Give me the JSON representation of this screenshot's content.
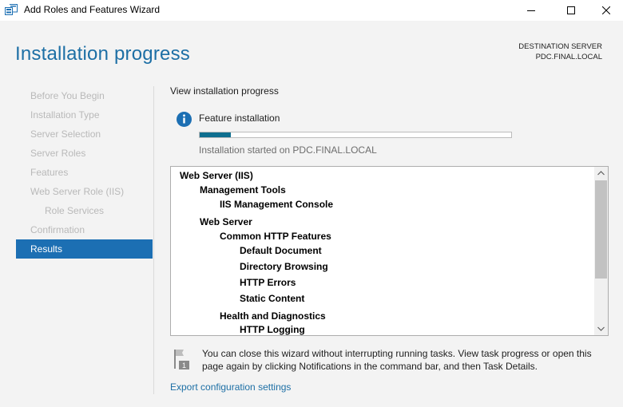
{
  "window": {
    "title": "Add Roles and Features Wizard",
    "icon": "server-manager-icon",
    "controls": [
      "minimize-icon",
      "maximize-icon",
      "close-icon"
    ]
  },
  "header": {
    "page_title": "Installation progress",
    "destination_label": "DESTINATION SERVER",
    "destination_value": "PDC.FINAL.LOCAL"
  },
  "nav": {
    "items": [
      {
        "label": "Before You Begin",
        "state": "disabled"
      },
      {
        "label": "Installation Type",
        "state": "disabled"
      },
      {
        "label": "Server Selection",
        "state": "disabled"
      },
      {
        "label": "Server Roles",
        "state": "disabled"
      },
      {
        "label": "Features",
        "state": "disabled"
      },
      {
        "label": "Web Server Role (IIS)",
        "state": "disabled"
      },
      {
        "label": "Role Services",
        "state": "disabled"
      },
      {
        "label": "Confirmation",
        "state": "disabled"
      },
      {
        "label": "Results",
        "state": "active"
      }
    ]
  },
  "content": {
    "section_label": "View installation progress",
    "feature_label": "Feature installation",
    "progress_fraction": 0.1,
    "status_text": "Installation started on PDC.FINAL.LOCAL",
    "results": [
      {
        "text": "Web Server (IIS)",
        "level": 0
      },
      {
        "text": "Management Tools",
        "level": 1
      },
      {
        "text": "IIS Management Console",
        "level": 2
      },
      {
        "text": "Web Server",
        "level": 1
      },
      {
        "text": "Common HTTP Features",
        "level": 2
      },
      {
        "text": "Default Document",
        "level": 3
      },
      {
        "text": "Directory Browsing",
        "level": 3
      },
      {
        "text": "HTTP Errors",
        "level": 3
      },
      {
        "text": "Static Content",
        "level": 3
      },
      {
        "text": "Health and Diagnostics",
        "level": 2
      },
      {
        "text": "HTTP Logging",
        "level": 3
      }
    ],
    "note": "You can close this wizard without interrupting running tasks. View task progress or open this page again by clicking Notifications in the command bar, and then Task Details.",
    "flag_badge": "1",
    "export_link": "Export configuration settings"
  },
  "colors": {
    "accent": "#1c6fb3",
    "title_blue": "#1d6fa5",
    "progress": "#0e6e8f",
    "disabled_text": "#b9b9b9"
  }
}
